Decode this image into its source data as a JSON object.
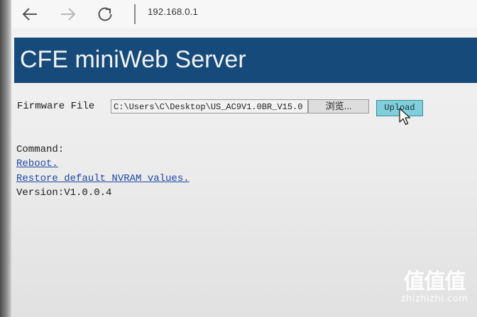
{
  "browser": {
    "back_icon": "arrow-left-icon",
    "forward_icon": "arrow-right-icon",
    "refresh_icon": "refresh-icon",
    "address": "192.168.0.1"
  },
  "page": {
    "banner_title": "CFE miniWeb Server",
    "banner_color": "#164a7a",
    "firmware_label": "Firmware File",
    "file_path": "C:\\Users\\C\\Desktop\\US_AC9V1.0BR_V15.0",
    "browse_label": "浏览...",
    "upload_label": "Upload",
    "command_label": "Command:",
    "reboot_link": "Reboot.",
    "restore_link": "Restore default NVRAM values.",
    "version": "Version:V1.0.0.4"
  },
  "watermark": {
    "main": "值值值",
    "site": "zhizhizhi.com"
  }
}
